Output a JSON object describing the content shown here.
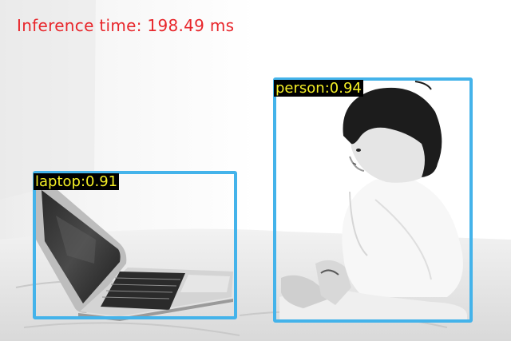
{
  "inference": {
    "text": "Inference time: 198.49 ms"
  },
  "detections": [
    {
      "label": "laptop:0.91"
    },
    {
      "label": "person:0.94"
    }
  ],
  "colors": {
    "box": "#44b3ea",
    "label_text": "#f4ee26",
    "label_bg": "#000000",
    "inference_text": "#e8262b"
  }
}
